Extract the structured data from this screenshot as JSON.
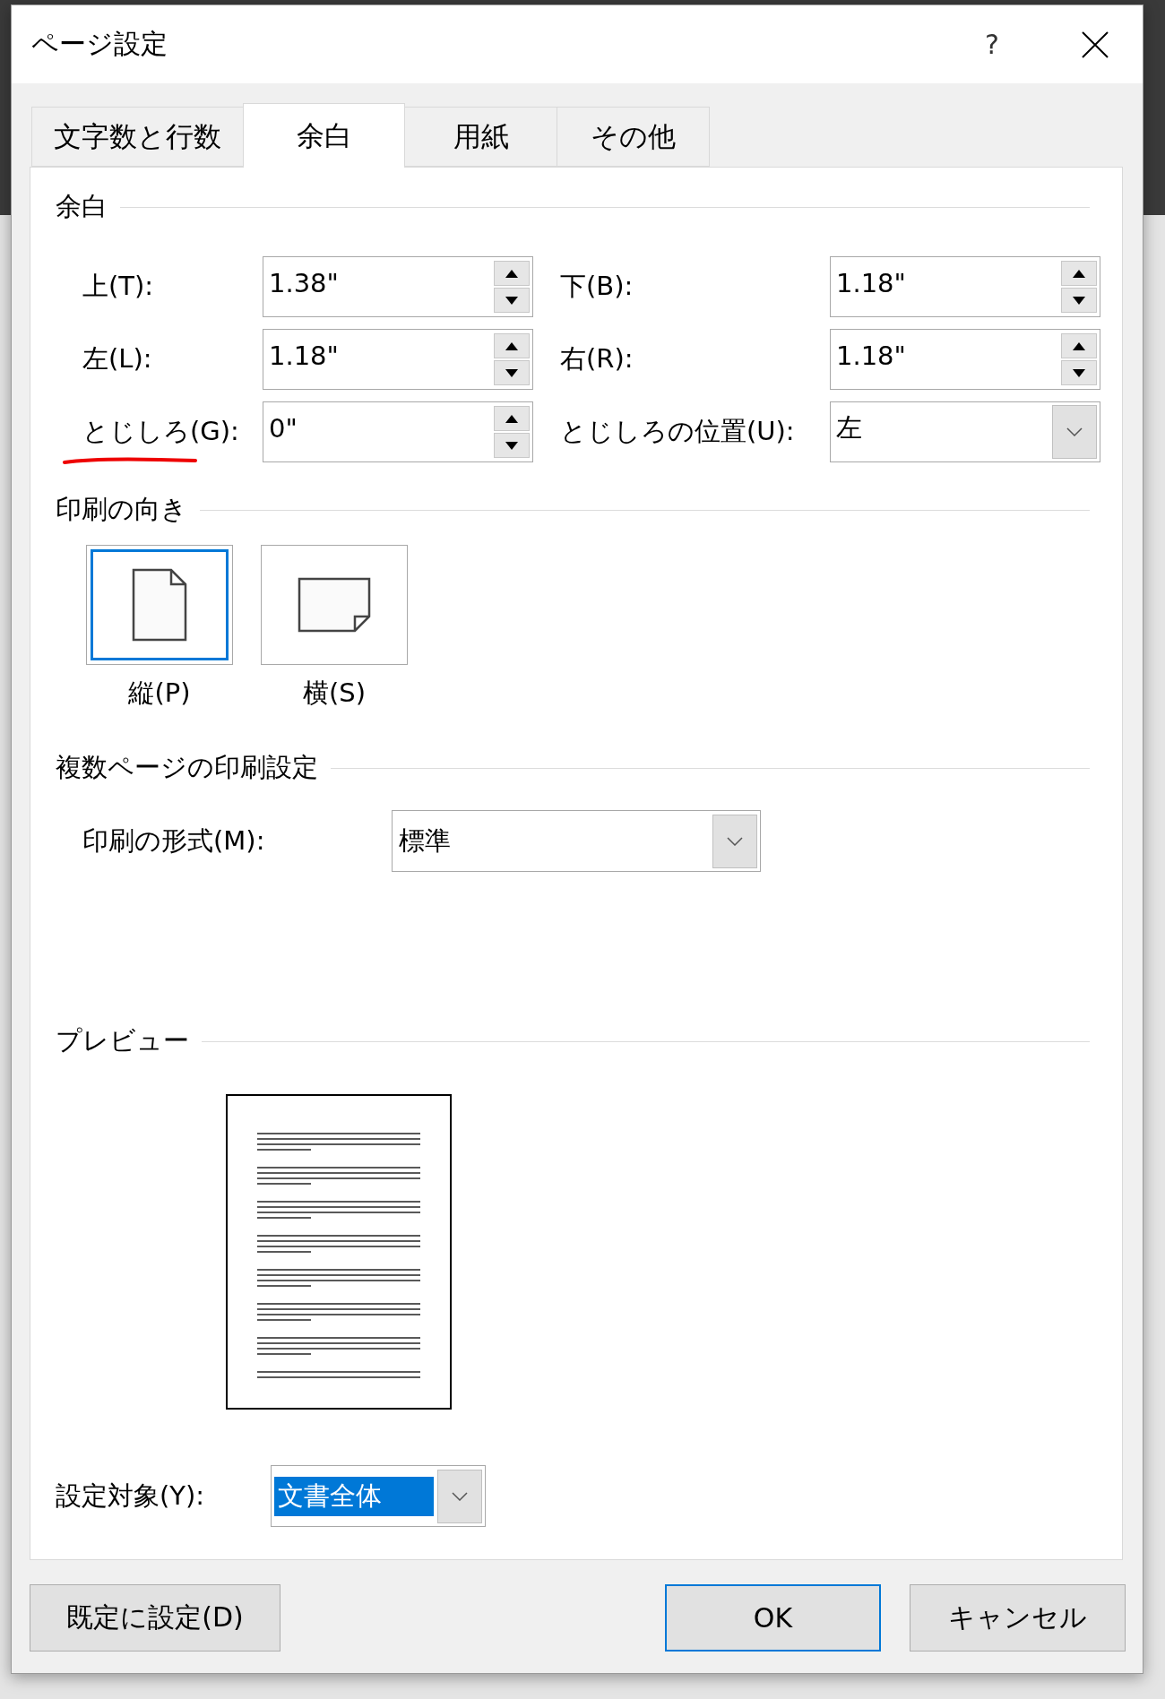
{
  "window": {
    "title": "ページ設定",
    "help": "?"
  },
  "tabs": [
    {
      "label": "文字数と行数",
      "selected": false
    },
    {
      "label": "余白",
      "selected": true
    },
    {
      "label": "用紙",
      "selected": false
    },
    {
      "label": "その他",
      "selected": false
    }
  ],
  "margins": {
    "heading": "余白",
    "fields": [
      {
        "label": "上(T):",
        "value": "1.38\"",
        "kind": "spin",
        "annotated": false
      },
      {
        "label": "下(B):",
        "value": "1.18\"",
        "kind": "spin",
        "annotated": false
      },
      {
        "label": "左(L):",
        "value": "1.18\"",
        "kind": "spin",
        "annotated": false
      },
      {
        "label": "右(R):",
        "value": "1.18\"",
        "kind": "spin",
        "annotated": false
      },
      {
        "label": "とじしろ(G):",
        "value": "0\"",
        "kind": "spin",
        "annotated": true
      },
      {
        "label": "とじしろの位置(U):",
        "value": "左",
        "kind": "select",
        "annotated": false
      }
    ]
  },
  "orientation": {
    "heading": "印刷の向き",
    "options": [
      {
        "label": "縦(P)",
        "selected": true,
        "kind": "portrait"
      },
      {
        "label": "横(S)",
        "selected": false,
        "kind": "landscape"
      }
    ]
  },
  "multiple_pages": {
    "heading": "複数ページの印刷設定",
    "label": "印刷の形式(M):",
    "value": "標準"
  },
  "preview": {
    "heading": "プレビュー"
  },
  "apply_to": {
    "label": "設定対象(Y):",
    "value": "文書全体"
  },
  "buttons": [
    {
      "label": "既定に設定(D)",
      "kind": "default"
    },
    {
      "label": "OK",
      "kind": "primary"
    },
    {
      "label": "キャンセル",
      "kind": "cancel"
    }
  ]
}
